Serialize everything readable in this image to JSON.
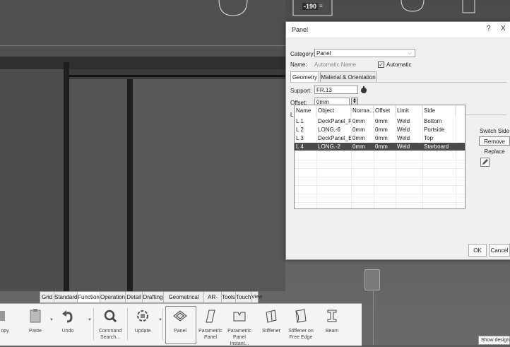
{
  "viewport": {
    "dimension_label": "-190",
    "dimension_suffix": "≡"
  },
  "dialog": {
    "title": "Panel",
    "help_label": "?",
    "close_label": "X",
    "category_label": "Category:",
    "category_value": "Panel",
    "name_label": "Name:",
    "name_value": "Automatic Name",
    "automatic_label": "Automatic",
    "automatic_checked": true,
    "tabs": [
      {
        "label": "Geometry",
        "active": true
      },
      {
        "label": "Material & Orientation",
        "active": false
      }
    ],
    "support_label": "Support:",
    "support_value": "FR.13",
    "offset_label": "Offset:",
    "offset_value": "0mm",
    "limits_label": "Limits",
    "table": {
      "headers": [
        "Name",
        "Object",
        "Norma...",
        "Offset",
        "Limit",
        "Side"
      ],
      "rows": [
        {
          "name": "L 1",
          "object": "DeckPanel_Pe...",
          "normal": "0mm",
          "offset": "0mm",
          "limit": "Weld",
          "side": "Bottom",
          "selected": false
        },
        {
          "name": "L 2",
          "object": "LONG.-6",
          "normal": "0mm",
          "offset": "0mm",
          "limit": "Weld",
          "side": "Portside",
          "selected": false
        },
        {
          "name": "L 3",
          "object": "DeckPanel_En...",
          "normal": "0mm",
          "offset": "0mm",
          "limit": "Weld",
          "side": "Top",
          "selected": false
        },
        {
          "name": "L 4",
          "object": "LONG.-2",
          "normal": "0mm",
          "offset": "0mm",
          "limit": "Weld",
          "side": "Starboard",
          "selected": true
        }
      ]
    },
    "side_buttons": [
      "Switch Side",
      "Remove",
      "Replace"
    ],
    "edit_icon": "pencil-icon",
    "ok_label": "OK",
    "cancel_label": "Cancel"
  },
  "workbench_tabs": [
    {
      "label": "Grid",
      "active": false
    },
    {
      "label": "Standard",
      "active": false
    },
    {
      "label": "Function",
      "active": true
    },
    {
      "label": "Operation",
      "active": false
    },
    {
      "label": "Detail",
      "active": false
    },
    {
      "label": "Drafting",
      "active": false
    },
    {
      "label": "Geometrical Tools",
      "active": false
    },
    {
      "label": "AR-VR",
      "active": false
    },
    {
      "label": "Tools",
      "active": false
    },
    {
      "label": "Touch",
      "active": false
    },
    {
      "label": "View",
      "active": false
    }
  ],
  "ribbon": {
    "copy_label": "opy",
    "paste_label": "Paste",
    "undo_label": "Undo",
    "command_search_label": "Command Search...",
    "update_label": "Update",
    "panel_label": "Panel",
    "parametric_panel_label": "Parametric Panel",
    "parametric_panel_instant_label": "Parametric Panel Instant...",
    "stiffener_label": "Stiffener",
    "stiffener_free_edge_label": "Stiffener on Free Edge",
    "beam_label": "Beam"
  },
  "corner_popup": "Show design"
}
